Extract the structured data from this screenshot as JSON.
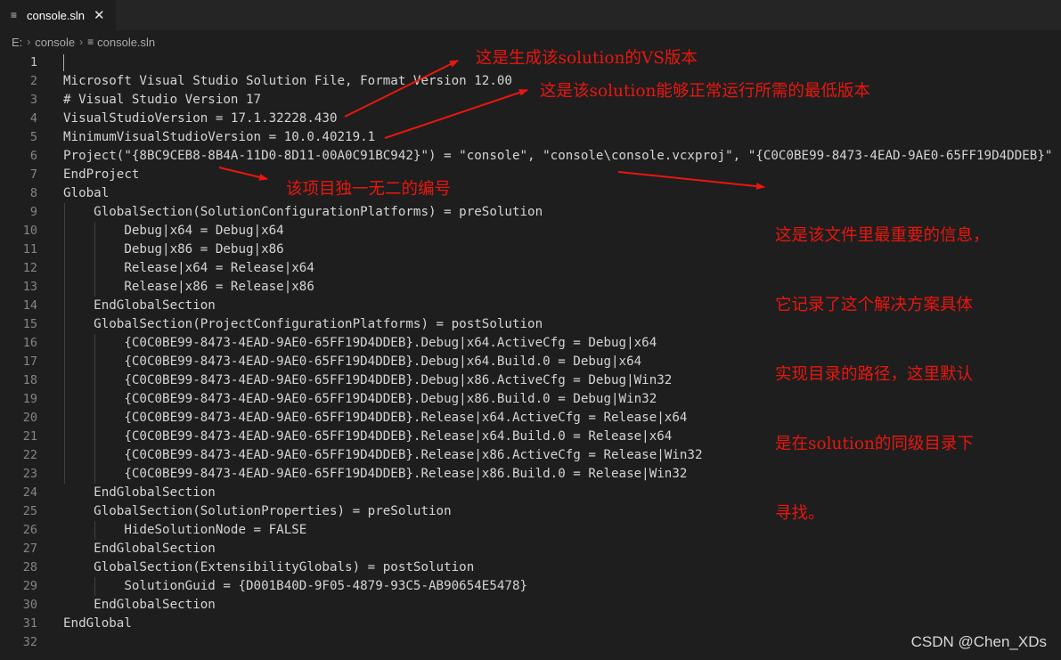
{
  "tab": {
    "icon": "lines-file-icon",
    "label": "console.sln",
    "close": "✕"
  },
  "breadcrumb": {
    "drive": "E:",
    "folder": "console",
    "file": "console.sln"
  },
  "code_lines": [
    "",
    "Microsoft Visual Studio Solution File, Format Version 12.00",
    "# Visual Studio Version 17",
    "VisualStudioVersion = 17.1.32228.430",
    "MinimumVisualStudioVersion = 10.0.40219.1",
    "Project(\"{8BC9CEB8-8B4A-11D0-8D11-00A0C91BC942}\") = \"console\", \"console\\console.vcxproj\", \"{C0C0BE99-8473-4EAD-9AE0-65FF19D4DDEB}\"",
    "EndProject",
    "Global",
    "    GlobalSection(SolutionConfigurationPlatforms) = preSolution",
    "        Debug|x64 = Debug|x64",
    "        Debug|x86 = Debug|x86",
    "        Release|x64 = Release|x64",
    "        Release|x86 = Release|x86",
    "    EndGlobalSection",
    "    GlobalSection(ProjectConfigurationPlatforms) = postSolution",
    "        {C0C0BE99-8473-4EAD-9AE0-65FF19D4DDEB}.Debug|x64.ActiveCfg = Debug|x64",
    "        {C0C0BE99-8473-4EAD-9AE0-65FF19D4DDEB}.Debug|x64.Build.0 = Debug|x64",
    "        {C0C0BE99-8473-4EAD-9AE0-65FF19D4DDEB}.Debug|x86.ActiveCfg = Debug|Win32",
    "        {C0C0BE99-8473-4EAD-9AE0-65FF19D4DDEB}.Debug|x86.Build.0 = Debug|Win32",
    "        {C0C0BE99-8473-4EAD-9AE0-65FF19D4DDEB}.Release|x64.ActiveCfg = Release|x64",
    "        {C0C0BE99-8473-4EAD-9AE0-65FF19D4DDEB}.Release|x64.Build.0 = Release|x64",
    "        {C0C0BE99-8473-4EAD-9AE0-65FF19D4DDEB}.Release|x86.ActiveCfg = Release|Win32",
    "        {C0C0BE99-8473-4EAD-9AE0-65FF19D4DDEB}.Release|x86.Build.0 = Release|Win32",
    "    EndGlobalSection",
    "    GlobalSection(SolutionProperties) = preSolution",
    "        HideSolutionNode = FALSE",
    "    EndGlobalSection",
    "    GlobalSection(ExtensibilityGlobals) = postSolution",
    "        SolutionGuid = {D001B40D-9F05-4879-93C5-AB90654E5478}",
    "    EndGlobalSection",
    "EndGlobal",
    ""
  ],
  "annotations": {
    "vs_version": "这是生成该solution的VS版本",
    "min_version": "这是该solution能够正常运行所需的最低版本",
    "project_id": "该项目独一无二的编号",
    "important_info": [
      "这是该文件里最重要的信息，",
      "它记录了这个解决方案具体",
      "实现目录的路径，这里默认",
      "是在solution的同级目录下",
      "寻找。"
    ]
  },
  "watermark": "CSDN @Chen_XDs",
  "colors": {
    "editor_bg": "#1e1e1e",
    "text": "#d4d4d4",
    "line_number": "#858585",
    "annotation": "#e8170f"
  }
}
